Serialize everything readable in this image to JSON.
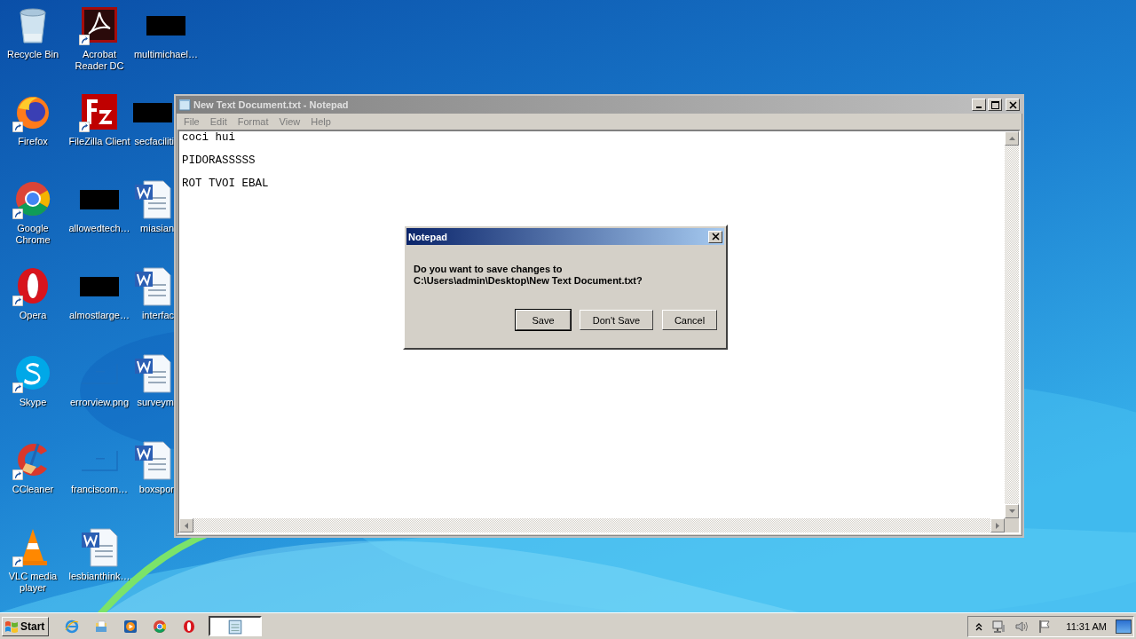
{
  "desktop_icons": [
    {
      "label": "Recycle Bin",
      "kind": "recycle",
      "shortcut": false
    },
    {
      "label": "Firefox",
      "kind": "firefox",
      "shortcut": true
    },
    {
      "label": "Google Chrome",
      "kind": "chrome",
      "shortcut": true
    },
    {
      "label": "Opera",
      "kind": "opera",
      "shortcut": true
    },
    {
      "label": "Skype",
      "kind": "skype",
      "shortcut": true
    },
    {
      "label": "CCleaner",
      "kind": "ccleaner",
      "shortcut": true
    },
    {
      "label": "VLC media player",
      "kind": "vlc",
      "shortcut": true
    },
    {
      "label": "Acrobat Reader DC",
      "kind": "acrobat",
      "shortcut": true
    },
    {
      "label": "FileZilla Client",
      "kind": "filezilla",
      "shortcut": true
    },
    {
      "label": "allowedtech…",
      "kind": "redacted",
      "shortcut": false
    },
    {
      "label": "almostlarge…",
      "kind": "redacted",
      "shortcut": false
    },
    {
      "label": "errorview.png",
      "kind": "blank",
      "shortcut": false
    },
    {
      "label": "franciscom…",
      "kind": "blank",
      "shortcut": false
    },
    {
      "label": "lesbianthink…",
      "kind": "word",
      "shortcut": false
    },
    {
      "label": "multimichael…",
      "kind": "redacted",
      "shortcut": false
    },
    {
      "label": "secfaciliti",
      "kind": "redacted",
      "shortcut": false
    },
    {
      "label": "miasian",
      "kind": "word",
      "shortcut": false
    },
    {
      "label": "interfac",
      "kind": "word",
      "shortcut": false
    },
    {
      "label": "surveym",
      "kind": "word",
      "shortcut": false
    },
    {
      "label": "boxspor",
      "kind": "word",
      "shortcut": false
    }
  ],
  "notepad": {
    "title": "New Text Document.txt - Notepad",
    "active": false,
    "menu": [
      "File",
      "Edit",
      "Format",
      "View",
      "Help"
    ],
    "lines": [
      "coci hui",
      "PIDORASSSSS",
      "ROT TVOI EBAL"
    ]
  },
  "dialog": {
    "title": "Notepad",
    "message": [
      "Do you want to save changes to",
      "C:\\Users\\admin\\Desktop\\New Text Document.txt?"
    ],
    "buttons": [
      {
        "label": "Save",
        "default": true
      },
      {
        "label": "Don't Save",
        "default": false
      },
      {
        "label": "Cancel",
        "default": false
      }
    ]
  },
  "taskbar": {
    "start": "Start",
    "quick_launch": [
      {
        "kind": "ie"
      },
      {
        "kind": "explorer"
      },
      {
        "kind": "media"
      },
      {
        "kind": "chrome"
      },
      {
        "kind": "opera"
      }
    ],
    "tasks": [
      {
        "kind": "notepad",
        "selected": true
      }
    ],
    "clock": "11:31 AM"
  }
}
